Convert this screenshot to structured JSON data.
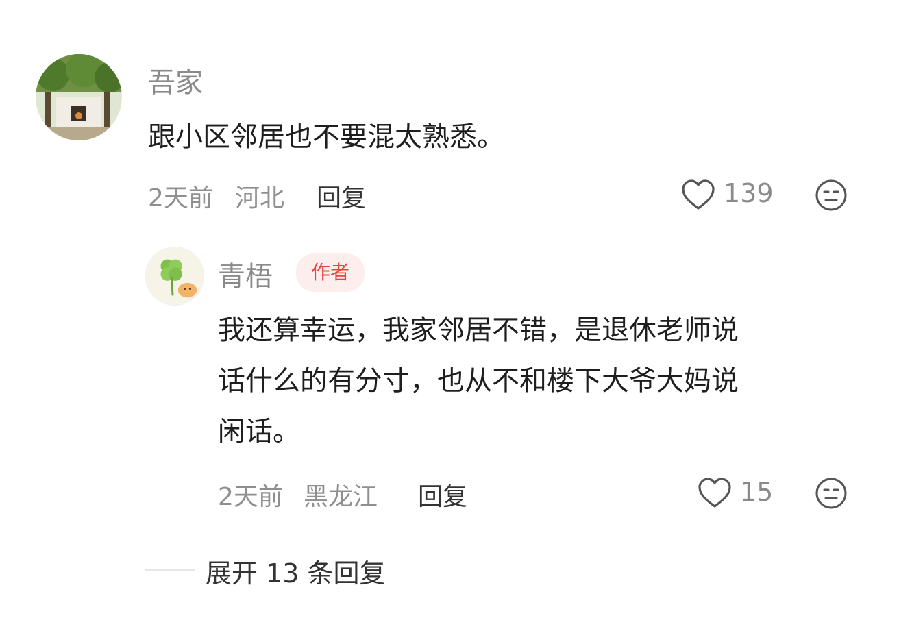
{
  "comment": {
    "username": "吾家",
    "text": "跟小区邻居也不要混太熟悉。",
    "time": "2天前",
    "location": "河北",
    "reply_label": "回复",
    "likes": "139",
    "like_icon": "heart-outline-icon",
    "dislike_icon": "meh-face-icon"
  },
  "reply": {
    "username": "青梧",
    "badge": "作者",
    "text_lines": [
      "我还算幸运，我家邻居不错，是退休老师说",
      "话什么的有分寸，也从不和楼下大爷大妈说",
      "闲话。"
    ],
    "time": "2天前",
    "location": "黑龙江",
    "reply_label": "回复",
    "likes": "15",
    "like_icon": "heart-outline-icon",
    "dislike_icon": "meh-face-icon"
  },
  "expand_replies": {
    "label": "展开 13 条回复"
  },
  "colors": {
    "badge_text": "#e8443f",
    "badge_bg": "#fdeeee",
    "meta_gray": "#8f8f8f"
  }
}
